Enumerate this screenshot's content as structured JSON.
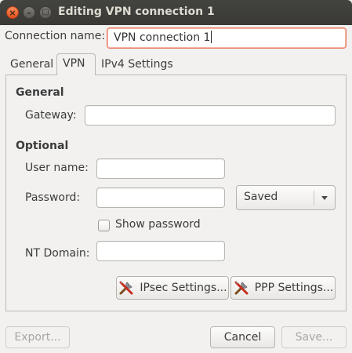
{
  "window": {
    "title": "Editing VPN connection 1",
    "close_glyph": "×",
    "minimize_glyph": "–",
    "maximize_glyph": "□"
  },
  "connection": {
    "name_label": "Connection name:",
    "name_value": "VPN connection 1"
  },
  "tabs": [
    {
      "label": "General"
    },
    {
      "label": "VPN"
    },
    {
      "label": "IPv4 Settings"
    }
  ],
  "vpn": {
    "general_heading": "General",
    "gateway_label": "Gateway:",
    "gateway_value": "",
    "optional_heading": "Optional",
    "username_label": "User name:",
    "username_value": "",
    "password_label": "Password:",
    "password_value": "",
    "password_storage": "Saved",
    "show_password_label": "Show password",
    "show_password_checked": false,
    "nt_domain_label": "NT Domain:",
    "nt_domain_value": "",
    "ipsec_button": "IPsec Settings...",
    "ppp_button": "PPP Settings...",
    "icons": [
      "tools-icon",
      "tools-icon"
    ]
  },
  "footer": {
    "export_button": "Export...",
    "cancel_button": "Cancel",
    "save_button": "Save..."
  }
}
